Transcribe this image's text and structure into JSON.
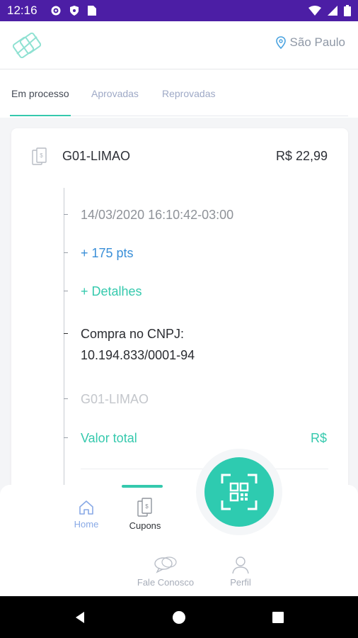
{
  "status_bar": {
    "time": "12:16"
  },
  "header": {
    "location": "São Paulo"
  },
  "tabs": [
    {
      "label": "Em processo",
      "active": true
    },
    {
      "label": "Aprovadas",
      "active": false
    },
    {
      "label": "Reprovadas",
      "active": false
    }
  ],
  "card": {
    "title": "G01-LIMAO",
    "amount": "R$ 22,99",
    "datetime": "14/03/2020 16:10:42-03:00",
    "points": "+ 175 pts",
    "details_link": "+ Detalhes",
    "cnpj_label": "Compra no CNPJ:",
    "cnpj_value": "10.194.833/0001-94",
    "store_name": "G01-LIMAO",
    "total_label": "Valor total",
    "total_value": "R$"
  },
  "bottom_nav": {
    "home": "Home",
    "cupons": "Cupons",
    "fale": "Fale Conosco",
    "perfil": "Perfil"
  },
  "colors": {
    "status_bar": "#4c1ea5",
    "accent": "#35c9ad",
    "link_blue": "#3a8fd8"
  }
}
